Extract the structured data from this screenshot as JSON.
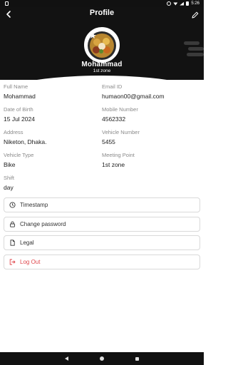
{
  "status_bar": {
    "time": "5:26"
  },
  "header": {
    "title": "Profile",
    "name": "Mohammad",
    "zone": "1st zone"
  },
  "fields": [
    {
      "left": {
        "label": "Full Name",
        "value": "Mohammad"
      },
      "right": {
        "label": "Email ID",
        "value": "humaon00@gmail.com"
      }
    },
    {
      "left": {
        "label": "Date of Birth",
        "value": "15 Jul 2024"
      },
      "right": {
        "label": "Mobile Number",
        "value": "4562332"
      }
    },
    {
      "left": {
        "label": "Address",
        "value": "Niketon, Dhaka."
      },
      "right": {
        "label": "Vehicle Number",
        "value": "5455"
      }
    },
    {
      "left": {
        "label": "Vehicle Type",
        "value": "Bike"
      },
      "right": {
        "label": "Meeting Point",
        "value": "1st zone"
      }
    },
    {
      "left": {
        "label": "Shift",
        "value": "day"
      }
    }
  ],
  "actions": {
    "timestamp": "Timestamp",
    "change_password": "Change password",
    "legal": "Legal",
    "logout": "Log Out"
  },
  "colors": {
    "header_bg": "#121212",
    "danger": "#e0474c",
    "border": "#d9d9d9"
  }
}
